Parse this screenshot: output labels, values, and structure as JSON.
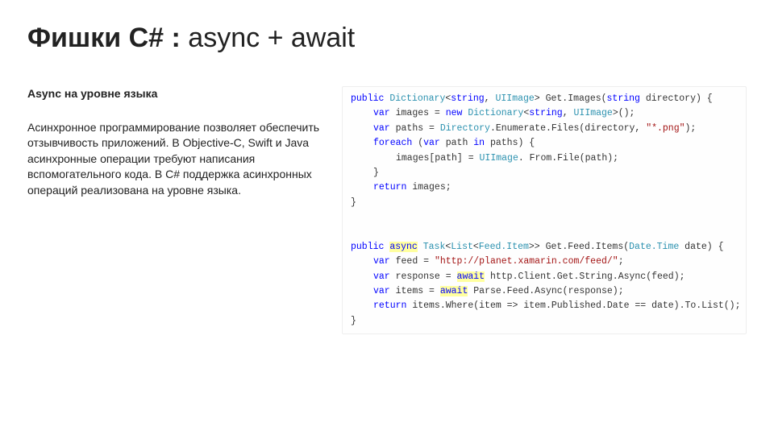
{
  "title": {
    "bold": "Фишки C# :",
    "rest": " async + await"
  },
  "left": {
    "subheading": "Async на уровне языка",
    "paragraph": "Асинхронное программирование позволяет обеспечить отзывчивость приложений. В Objective-C, Swift и Java асинхронные операции требуют написания вспомогательного кода. В C# поддержка асинхронных операций реализована на уровне языка."
  },
  "code": {
    "l01_kw1": "public",
    "l01_typ1": "Dictionary",
    "l01_gen1": "<",
    "l01_typ2": "string",
    "l01_sep1": ", ",
    "l01_typ3": "UIImage",
    "l01_gen2": ">",
    "l01_name": " Get.Images(",
    "l01_typ4": "string",
    "l01_arg": " directory) {",
    "l02_kw1": "var",
    "l02_txt1": " images = ",
    "l02_kw2": "new",
    "l02_txt2": " ",
    "l02_typ1": "Dictionary",
    "l02_gen1": "<",
    "l02_typ2": "string",
    "l02_sep": ", ",
    "l02_typ3": "UIImage",
    "l02_gen2": ">",
    "l02_end": "();",
    "l03_kw1": "var",
    "l03_txt1": " paths = ",
    "l03_typ1": "Directory",
    "l03_txt2": ".Enumerate.Files(directory, ",
    "l03_str": "\"*.png\"",
    "l03_end": ");",
    "l04_kw1": "foreach",
    "l04_txt1": " (",
    "l04_kw2": "var",
    "l04_txt2": " path ",
    "l04_kw3": "in",
    "l04_txt3": " paths) {",
    "l05_txt1": "images[path] = ",
    "l05_typ1": "UIImage",
    "l05_txt2": ". From.File(path);",
    "l06": "}",
    "l07_kw1": "return",
    "l07_txt": " images;",
    "l08": "}",
    "l10_kw1": "public",
    "l10_sp": " ",
    "l10_hl1": "async",
    "l10_sp2": " ",
    "l10_typ1": "Task",
    "l10_gen1": "<",
    "l10_typ2": "List",
    "l10_gen2": "<",
    "l10_typ3": "Feed.Item",
    "l10_gen3": ">>",
    "l10_name": " Get.Feed.Items(",
    "l10_typ4": "Date.Time",
    "l10_arg": " date) {",
    "l11_kw1": "var",
    "l11_txt1": " feed = ",
    "l11_str": "\"http://planet.xamarin.com/feed/\"",
    "l11_end": ";",
    "l12_kw1": "var",
    "l12_txt1": " response = ",
    "l12_hl": "await",
    "l12_txt2": " http.Client.Get.String.Async(feed);",
    "l13_kw1": "var",
    "l13_txt1": " items = ",
    "l13_hl": "await",
    "l13_txt2": " Parse.Feed.Async(response);",
    "l14_kw1": "return",
    "l14_txt": " items.Where(item => item.Published.Date == date).To.List();",
    "l15": "}"
  }
}
